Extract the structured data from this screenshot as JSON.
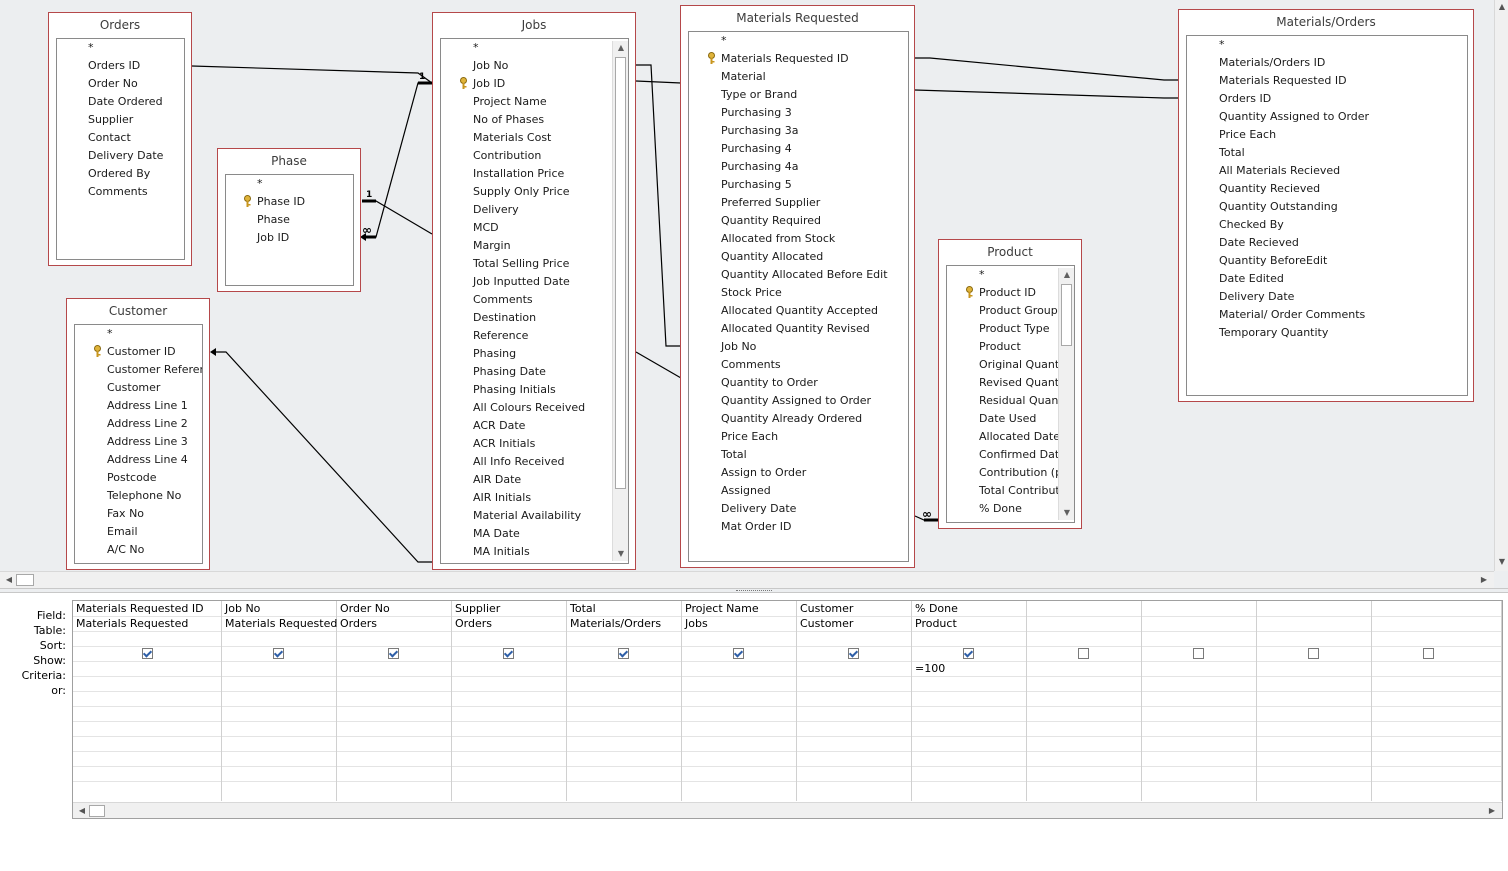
{
  "tables": {
    "orders": {
      "title": "Orders",
      "fields": [
        "*",
        "Orders ID",
        "Order No",
        "Date Ordered",
        "Supplier",
        "Contact",
        "Delivery Date",
        "Ordered By",
        "Comments"
      ]
    },
    "phase": {
      "title": "Phase",
      "fields": [
        "*",
        "Phase ID",
        "Phase",
        "Job ID"
      ]
    },
    "customer": {
      "title": "Customer",
      "fields": [
        "*",
        "Customer ID",
        "Customer Referenc",
        "Customer",
        "Address Line 1",
        "Address Line 2",
        "Address Line 3",
        "Address Line 4",
        "Postcode",
        "Telephone No",
        "Fax No",
        "Email",
        "A/C No"
      ]
    },
    "jobs": {
      "title": "Jobs",
      "fields": [
        "*",
        "Job No",
        "Job ID",
        "Project Name",
        "No of Phases",
        "Materials Cost",
        "Contribution",
        "Installation Price",
        "Supply Only Price",
        "Delivery",
        "MCD",
        "Margin",
        "Total Selling Price",
        "Job Inputted Date",
        "Comments",
        "Destination",
        "Reference",
        "Phasing",
        "Phasing Date",
        "Phasing Initials",
        "All Colours Received",
        "ACR Date",
        "ACR Initials",
        "All Info Received",
        "AIR Date",
        "AIR Initials",
        "Material Availability",
        "MA Date",
        "MA Initials"
      ]
    },
    "materials_requested": {
      "title": "Materials Requested",
      "fields": [
        "*",
        "Materials Requested ID",
        "Material",
        "Type or Brand",
        "Purchasing 3",
        "Purchasing 3a",
        "Purchasing 4",
        "Purchasing 4a",
        "Purchasing 5",
        "Preferred Supplier",
        "Quantity Required",
        "Allocated from Stock",
        "Quantity Allocated",
        "Quantity Allocated Before Edit",
        "Stock Price",
        "Allocated Quantity Accepted",
        "Allocated Quantity Revised",
        "Job No",
        "Comments",
        "Quantity to Order",
        "Quantity Assigned to Order",
        "Quantity Already Ordered",
        "Price Each",
        "Total",
        "Assign to Order",
        "Assigned",
        "Delivery Date",
        "Mat Order ID"
      ]
    },
    "product": {
      "title": "Product",
      "fields": [
        "*",
        "Product ID",
        "Product Group",
        "Product Type",
        "Product",
        "Original Quant",
        "Revised Quanti",
        "Residual Quant",
        "Date Used",
        "Allocated Date",
        "Confirmed Date",
        "Contribution (p",
        "Total Contribut",
        "% Done"
      ]
    },
    "materials_orders": {
      "title": "Materials/Orders",
      "fields": [
        "*",
        "Materials/Orders ID",
        "Materials Requested ID",
        "Orders ID",
        "Quantity Assigned to Order",
        "Price Each",
        "Total",
        "All Materials Recieved",
        "Quantity Recieved",
        "Quantity Outstanding",
        "Checked By",
        "Date Recieved",
        "Quantity BeforeEdit",
        "Date Edited",
        "Delivery Date",
        "Material/ Order Comments",
        "Temporary Quantity"
      ]
    }
  },
  "relationship_labels": {
    "one": "1",
    "many": "∞"
  },
  "grid": {
    "row_labels": {
      "field": "Field:",
      "table": "Table:",
      "sort": "Sort:",
      "show": "Show:",
      "criteria": "Criteria:",
      "or": "or:"
    },
    "columns": [
      {
        "field": "Materials Requested ID",
        "table": "Materials Requested",
        "sort": "",
        "show": true,
        "criteria": ""
      },
      {
        "field": "Job No",
        "table": "Materials Requested",
        "sort": "",
        "show": true,
        "criteria": ""
      },
      {
        "field": "Order No",
        "table": "Orders",
        "sort": "",
        "show": true,
        "criteria": ""
      },
      {
        "field": "Supplier",
        "table": "Orders",
        "sort": "",
        "show": true,
        "criteria": ""
      },
      {
        "field": "Total",
        "table": "Materials/Orders",
        "sort": "",
        "show": true,
        "criteria": ""
      },
      {
        "field": "Project Name",
        "table": "Jobs",
        "sort": "",
        "show": true,
        "criteria": ""
      },
      {
        "field": "Customer",
        "table": "Customer",
        "sort": "",
        "show": true,
        "criteria": ""
      },
      {
        "field": "% Done",
        "table": "Product",
        "sort": "",
        "show": true,
        "criteria": "=100"
      },
      {
        "field": "",
        "table": "",
        "sort": "",
        "show": false,
        "criteria": ""
      },
      {
        "field": "",
        "table": "",
        "sort": "",
        "show": false,
        "criteria": ""
      },
      {
        "field": "",
        "table": "",
        "sort": "",
        "show": false,
        "criteria": ""
      },
      {
        "field": "",
        "table": "",
        "sort": "",
        "show": false,
        "criteria": ""
      }
    ]
  },
  "scroll_glyphs": {
    "up": "▲",
    "down": "▼",
    "left": "◀",
    "right": "▶"
  },
  "colors": {
    "table_border": "#b5484a",
    "designer_bg": "#eceef0",
    "check": "#2e5fa8"
  }
}
